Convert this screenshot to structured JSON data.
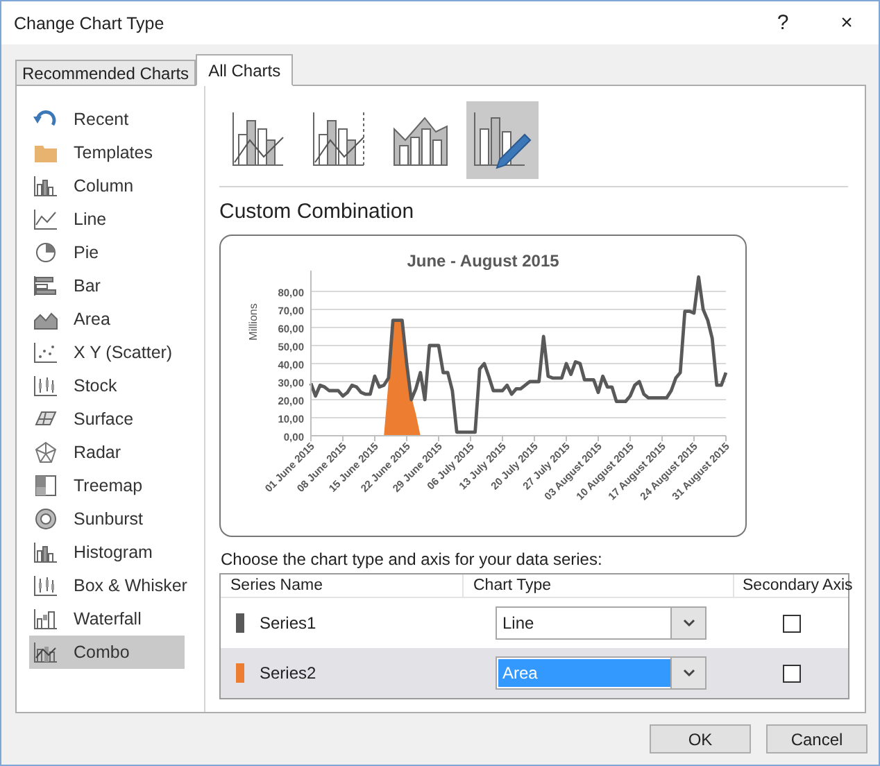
{
  "window": {
    "title": "Change Chart Type",
    "buttons": [
      "?",
      "×"
    ]
  },
  "tabs": [
    {
      "label": "Recommended Charts",
      "selected": false
    },
    {
      "label": "All Charts",
      "selected": true
    }
  ],
  "sidebar": {
    "items": [
      {
        "label": "Recent",
        "kind": "recent",
        "selected": false
      },
      {
        "label": "Templates",
        "kind": "templates",
        "selected": false
      },
      {
        "label": "Column",
        "kind": "column",
        "selected": false
      },
      {
        "label": "Line",
        "kind": "line",
        "selected": false
      },
      {
        "label": "Pie",
        "kind": "pie",
        "selected": false
      },
      {
        "label": "Bar",
        "kind": "bar",
        "selected": false
      },
      {
        "label": "Area",
        "kind": "area",
        "selected": false
      },
      {
        "label": "X Y (Scatter)",
        "kind": "scatter",
        "selected": false
      },
      {
        "label": "Stock",
        "kind": "stock",
        "selected": false
      },
      {
        "label": "Surface",
        "kind": "surface",
        "selected": false
      },
      {
        "label": "Radar",
        "kind": "radar",
        "selected": false
      },
      {
        "label": "Treemap",
        "kind": "treemap",
        "selected": false
      },
      {
        "label": "Sunburst",
        "kind": "sunburst",
        "selected": false
      },
      {
        "label": "Histogram",
        "kind": "histogram",
        "selected": false
      },
      {
        "label": "Box & Whisker",
        "kind": "boxwhisker",
        "selected": false
      },
      {
        "label": "Waterfall",
        "kind": "waterfall",
        "selected": false
      },
      {
        "label": "Combo",
        "kind": "combo",
        "selected": true
      }
    ]
  },
  "subtypes": [
    {
      "kind": "column-line",
      "selected": false
    },
    {
      "kind": "column-line-secondary",
      "selected": false
    },
    {
      "kind": "area-column",
      "selected": false
    },
    {
      "kind": "custom",
      "selected": true
    }
  ],
  "section_title": "Custom Combination",
  "chart": {
    "chart_data": {
      "type": "line",
      "title": "June - August 2015",
      "ylabel": "Millions",
      "categories": [
        "01 June 2015",
        null,
        null,
        null,
        null,
        null,
        null,
        "08 June 2015",
        null,
        null,
        null,
        null,
        null,
        null,
        "15 June 2015",
        null,
        null,
        null,
        null,
        null,
        null,
        "22 June 2015",
        null,
        null,
        null,
        null,
        null,
        null,
        "29 June 2015",
        null,
        null,
        null,
        null,
        null,
        null,
        "06 July 2015",
        null,
        null,
        null,
        null,
        null,
        null,
        "13 July 2015",
        null,
        null,
        null,
        null,
        null,
        null,
        "20 July 2015",
        null,
        null,
        null,
        null,
        null,
        null,
        "27 July 2015",
        null,
        null,
        null,
        null,
        null,
        null,
        "03 August 2015",
        null,
        null,
        null,
        null,
        null,
        null,
        "10 August 2015",
        null,
        null,
        null,
        null,
        null,
        null,
        "17 August 2015",
        null,
        null,
        null,
        null,
        null,
        null,
        "24 August 2015",
        null,
        null,
        null,
        null,
        null,
        null,
        "31 August 2015"
      ],
      "series": [
        {
          "color": "#595959",
          "values": [
            29,
            22,
            28,
            27,
            25,
            25,
            25,
            22,
            24,
            28,
            27,
            24,
            23,
            23,
            33,
            27,
            28,
            32,
            64,
            64,
            64,
            40,
            20,
            26,
            35,
            20,
            50,
            50,
            50,
            35,
            35,
            25,
            2,
            2,
            2,
            2,
            2,
            37,
            40,
            33,
            25,
            25,
            25,
            28,
            23,
            26,
            26,
            28,
            30,
            30,
            30,
            55,
            33,
            32,
            32,
            32,
            40,
            34,
            41,
            40,
            31,
            31,
            31,
            24,
            33,
            27,
            27,
            19,
            19,
            19,
            22,
            28,
            30,
            23,
            21,
            21,
            21,
            21,
            21,
            25,
            32,
            35,
            69,
            69,
            68,
            88,
            70,
            64,
            54,
            28,
            28,
            35
          ]
        },
        {
          "type": "area",
          "color": "#ed7d31",
          "values": [
            null,
            null,
            null,
            null,
            null,
            null,
            null,
            null,
            null,
            null,
            null,
            null,
            null,
            null,
            null,
            null,
            0,
            30,
            64,
            64,
            64,
            40,
            22,
            12,
            0,
            null,
            null,
            null,
            null,
            null,
            null,
            null,
            null,
            null,
            null,
            null,
            null,
            null,
            null,
            null,
            null,
            null,
            null,
            null,
            null,
            null,
            null,
            null,
            null,
            null,
            null,
            null,
            null,
            null,
            null,
            null,
            null,
            null,
            null,
            null,
            null,
            null,
            null,
            null,
            null,
            null,
            null,
            null,
            null,
            null,
            null,
            null,
            null,
            null,
            null,
            null,
            null,
            null,
            null,
            null,
            null,
            null,
            null,
            null,
            null,
            null,
            null,
            null,
            null,
            null,
            null,
            null
          ]
        }
      ],
      "grid": true,
      "ylim": [
        0,
        90
      ],
      "yticks": [
        {
          "value": 0,
          "label": "0,00"
        },
        {
          "value": 10,
          "label": "10,00"
        },
        {
          "value": 20,
          "label": "20,00"
        },
        {
          "value": 30,
          "label": "30,00"
        },
        {
          "value": 40,
          "label": "40,00"
        },
        {
          "value": 50,
          "label": "50,00"
        },
        {
          "value": 60,
          "label": "60,00"
        },
        {
          "value": 70,
          "label": "70,00"
        },
        {
          "value": 80,
          "label": "80,00"
        }
      ]
    }
  },
  "series_prompt": "Choose the chart type and axis for your data series:",
  "series_table": {
    "columns": [
      "Series Name",
      "Chart Type",
      "Secondary Axis"
    ],
    "rows": [
      {
        "name": "Series1",
        "color": "#595959",
        "chart_type": "Line",
        "secondary_axis": false,
        "selected": false
      },
      {
        "name": "Series2",
        "color": "#ed7d31",
        "chart_type": "Area",
        "secondary_axis": false,
        "selected": true
      }
    ]
  },
  "buttons": [
    "OK",
    "Cancel"
  ]
}
